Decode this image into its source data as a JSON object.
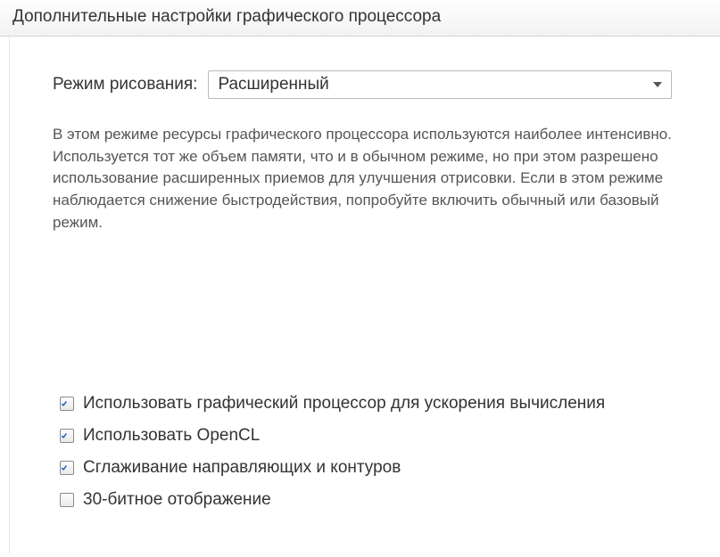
{
  "window": {
    "title": "Дополнительные настройки графического процессора"
  },
  "mode": {
    "label": "Режим рисования:",
    "selected": "Расширенный"
  },
  "description": "В этом режиме ресурсы графического процессора используются наиболее интенсивно.  Используется тот же объем памяти, что и в обычном режиме, но при этом разрешено использование расширенных приемов для улучшения отрисовки.  Если в этом режиме наблюдается снижение быстродействия, попробуйте включить обычный или базовый режим.",
  "options": [
    {
      "label": "Использовать графический процессор для ускорения вычисления",
      "checked": true
    },
    {
      "label": "Использовать OpenCL",
      "checked": true
    },
    {
      "label": "Сглаживание направляющих и контуров",
      "checked": true
    },
    {
      "label": "30-битное отображение",
      "checked": false
    }
  ]
}
